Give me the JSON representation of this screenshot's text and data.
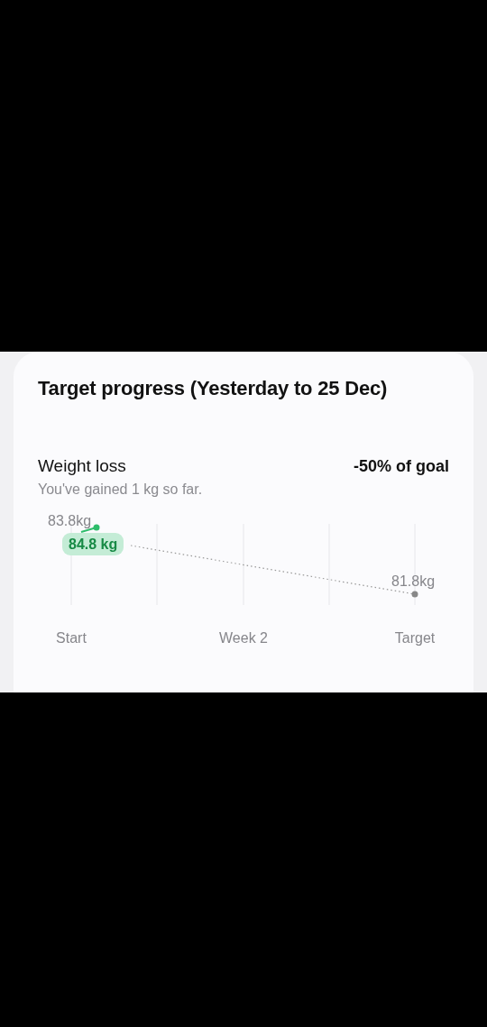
{
  "card": {
    "title": "Target progress (Yesterday to 25 Dec)",
    "metric": "Weight loss",
    "goal_share": "-50% of goal",
    "summary": "You've gained 1 kg so far.",
    "chart": {
      "start_label": "83.8kg",
      "current_badge": "84.8 kg",
      "target_label": "81.8kg",
      "axis_labels": [
        "Start",
        "Week 2",
        "Target"
      ]
    }
  }
}
